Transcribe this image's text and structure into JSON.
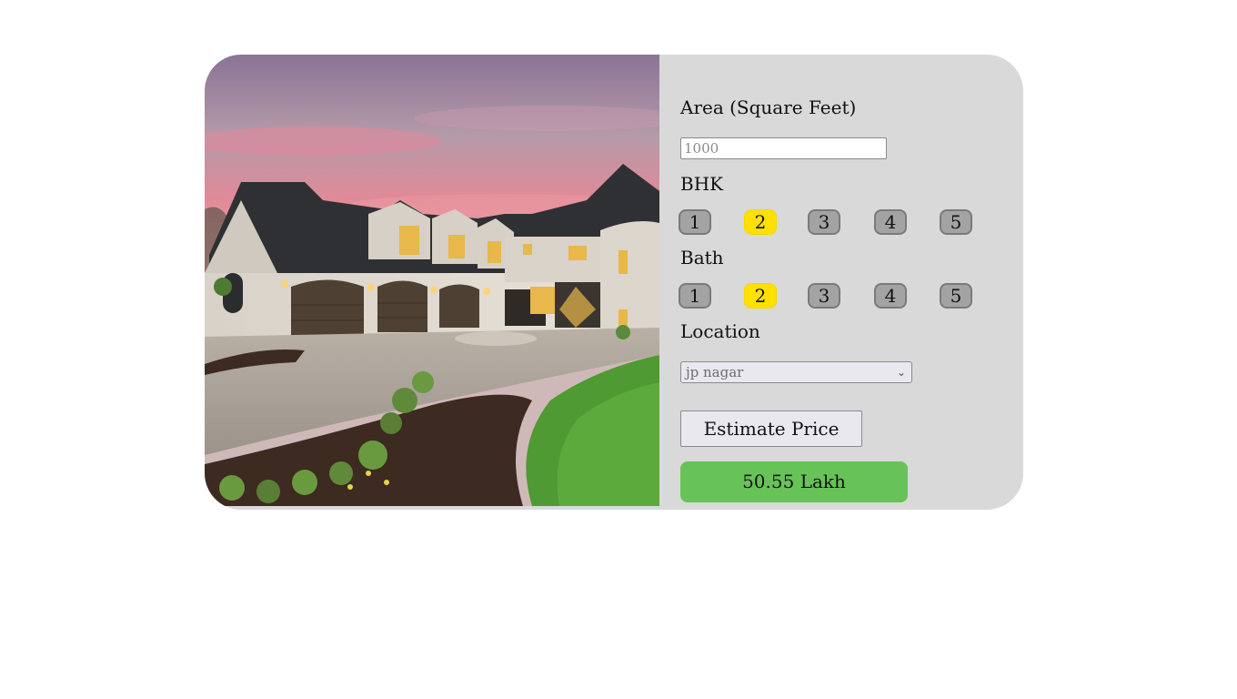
{
  "photo": {
    "alt": "Luxury house at dusk"
  },
  "form": {
    "area": {
      "label": "Area (Square Feet)",
      "placeholder": "1000",
      "value": ""
    },
    "bhk": {
      "label": "BHK",
      "options": [
        "1",
        "2",
        "3",
        "4",
        "5"
      ],
      "selected": "2"
    },
    "bath": {
      "label": "Bath",
      "options": [
        "1",
        "2",
        "3",
        "4",
        "5"
      ],
      "selected": "2"
    },
    "location": {
      "label": "Location",
      "selected": "jp nagar"
    },
    "estimate_label": "Estimate Price",
    "result": "50.55 Lakh"
  },
  "colors": {
    "card_bg": "#d9d9d9",
    "pill_default": "#a3a3a3",
    "pill_selected": "#ffe000",
    "result_bg": "#67c257"
  }
}
